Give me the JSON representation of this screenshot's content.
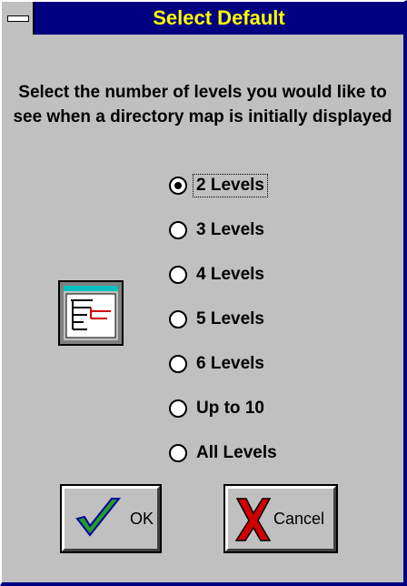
{
  "window": {
    "title": "Select Default"
  },
  "prompt": "Select the number of levels you would like to see when a directory map is initially displayed",
  "options": [
    {
      "label": "2 Levels",
      "selected": true
    },
    {
      "label": "3 Levels",
      "selected": false
    },
    {
      "label": "4 Levels",
      "selected": false
    },
    {
      "label": "5 Levels",
      "selected": false
    },
    {
      "label": "6 Levels",
      "selected": false
    },
    {
      "label": "Up to 10",
      "selected": false
    },
    {
      "label": "All Levels",
      "selected": false
    }
  ],
  "buttons": {
    "ok_label": "OK",
    "cancel_label": "Cancel"
  },
  "icons": {
    "sysmenu": "system-menu-icon",
    "map": "directory-map-icon",
    "ok": "checkmark-icon",
    "cancel": "x-icon"
  },
  "colors": {
    "title_bg": "#000080",
    "title_text": "#ffff00",
    "dialog_bg": "#c0c0c0",
    "ok_check": "#22a022",
    "cancel_x": "#d00000"
  }
}
